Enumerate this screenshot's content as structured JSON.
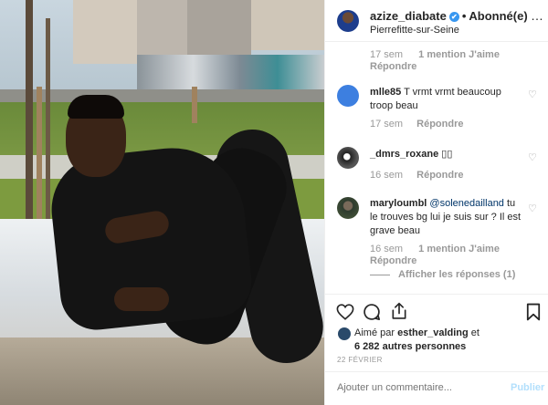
{
  "header": {
    "username": "azize_diabate",
    "verified_mark": "✔",
    "separator": "•",
    "follow_label": "Abonné(e)",
    "location": "Pierrefitte-sur-Seine",
    "more_icon": "more-dots-icon"
  },
  "comments": [
    {
      "time": "17 sem",
      "likes": "1 mention J'aime",
      "reply": "Répondre"
    },
    {
      "username": "mlle85",
      "text": "T vrmt vrmt beaucoup troop beau",
      "time": "17 sem",
      "reply": "Répondre",
      "avatar_color": "#3d7fe0"
    },
    {
      "username": "_dmrs_roxane",
      "text": "▯▯",
      "time": "16 sem",
      "reply": "Répondre"
    },
    {
      "username": "maryloumbl",
      "mention": "@solenedailland",
      "text": " tu le trouves bg lui je suis sur ? Il est grave beau",
      "time": "16 sem",
      "likes": "1 mention J'aime",
      "reply": "Répondre",
      "view_replies": "Afficher les réponses (1)"
    }
  ],
  "actions": {
    "like_icon": "heart-icon",
    "comment_icon": "comment-icon",
    "share_icon": "share-icon",
    "save_icon": "bookmark-icon"
  },
  "likes": {
    "prefix": "Aimé par ",
    "user": "esther_valding",
    "connector": " et",
    "count": "6 282 autres personnes"
  },
  "date": "22 FÉVRIER",
  "add_comment": {
    "placeholder": "Ajouter un commentaire...",
    "publish_label": "Publier"
  },
  "colors": {
    "verified": "#3897f0",
    "mention": "#003569",
    "publish_disabled": "#b2dffc"
  }
}
